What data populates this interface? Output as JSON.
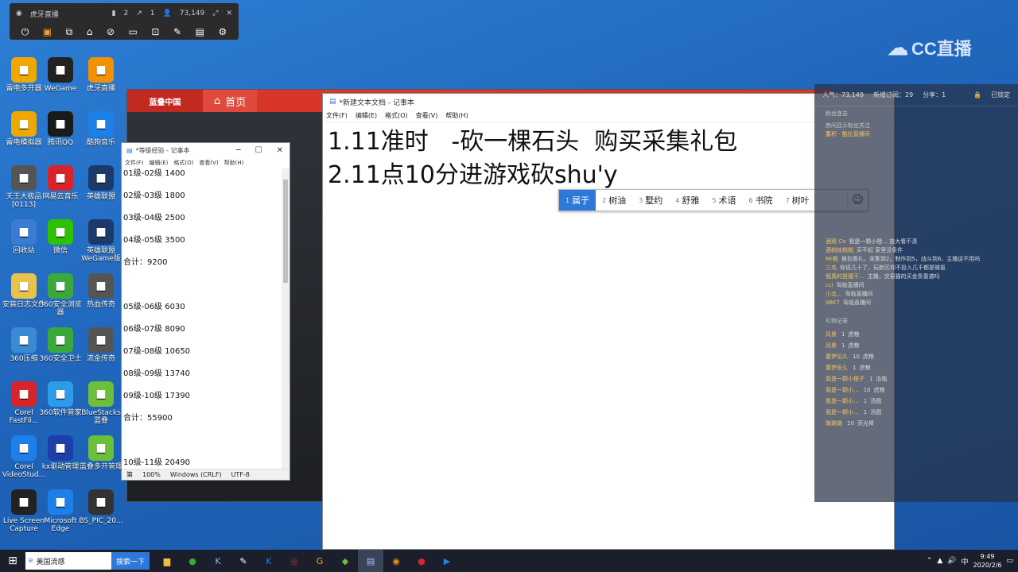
{
  "stream_bar": {
    "title": "虎牙直播",
    "stat1": "2",
    "stat2": "1",
    "viewers": "73,149"
  },
  "cc_logo": "CC直播",
  "desktop_icons": [
    {
      "label": "雷电多开器",
      "color": "#f0a800"
    },
    {
      "label": "WeGame",
      "color": "#222"
    },
    {
      "label": "虎牙直播",
      "color": "#f29200"
    },
    {
      "label": "雷电模拟器",
      "color": "#f0a800"
    },
    {
      "label": "腾讯QQ",
      "color": "#1a1a1a"
    },
    {
      "label": "酷狗音乐",
      "color": "#1d7fe8"
    },
    {
      "label": "天王大极品 [0113]",
      "color": "#555"
    },
    {
      "label": "网易云音乐",
      "color": "#d8232a"
    },
    {
      "label": "英雄联盟",
      "color": "#1b3a6b"
    },
    {
      "label": "回收站",
      "color": "#3a7bd5"
    },
    {
      "label": "微信",
      "color": "#2dc100"
    },
    {
      "label": "英雄联盟 WeGame版",
      "color": "#1b3a6b"
    },
    {
      "label": "安装日志文件",
      "color": "#e8c24a"
    },
    {
      "label": "360安全浏览器",
      "color": "#3aa83a"
    },
    {
      "label": "热血传奇",
      "color": "#555"
    },
    {
      "label": "360压缩",
      "color": "#3a8ad5"
    },
    {
      "label": "360安全卫士",
      "color": "#3aa83a"
    },
    {
      "label": "流金传奇",
      "color": "#555"
    },
    {
      "label": "Corel FastFli...",
      "color": "#d8232a"
    },
    {
      "label": "360软件管家",
      "color": "#2d9be8"
    },
    {
      "label": "BlueStacks 蓝叠",
      "color": "#6bbf3a"
    },
    {
      "label": "Corel VideoStud...",
      "color": "#1d7fe8"
    },
    {
      "label": "kx驱动管理",
      "color": "#1d3fa8"
    },
    {
      "label": "蓝叠多开管理",
      "color": "#6bbf3a"
    },
    {
      "label": "Live Screen Capture",
      "color": "#222"
    },
    {
      "label": "Microsoft Edge",
      "color": "#1d7fe8"
    },
    {
      "label": "BS_PIC_20...",
      "color": "#333"
    }
  ],
  "game_window": {
    "brand": "蓝叠中国",
    "home_tab": "首页"
  },
  "notepad_main": {
    "title": "*新建文本文档 - 记事本",
    "menu": [
      "文件(F)",
      "编辑(E)",
      "格式(O)",
      "查看(V)",
      "帮助(H)"
    ],
    "line1": "1.11准时   -砍一棵石头  购买采集礼包",
    "line2": "2.11点10分进游戏砍shu'y"
  },
  "ime": {
    "candidates": [
      {
        "n": "1",
        "text": "属于"
      },
      {
        "n": "2",
        "text": "树油"
      },
      {
        "n": "3",
        "text": "墅约"
      },
      {
        "n": "4",
        "text": "舒雅"
      },
      {
        "n": "5",
        "text": "术语"
      },
      {
        "n": "6",
        "text": "书院"
      },
      {
        "n": "7",
        "text": "树叶"
      }
    ],
    "emoji": "☺"
  },
  "notepad_small": {
    "title": "*等级经验 - 记事本",
    "menu": [
      "文件(F)",
      "编辑(E)",
      "格式(O)",
      "查看(V)",
      "帮助(H)"
    ],
    "lines": [
      "01级-02级  1400",
      "02级-03级  1800",
      "03级-04级  2500",
      "04级-05级  3500",
      "合计：9200",
      "",
      "05级-06级  6030",
      "06级-07级  8090",
      "07级-08级  10650",
      "08级-09级  13740",
      "09级-10级  17390",
      "合计：55900",
      "",
      "10级-11级  20490"
    ],
    "status": [
      "第",
      "100%",
      "Windows (CRLF)",
      "UTF-8"
    ]
  },
  "chat": {
    "header": {
      "viewers": "人气：73,149",
      "new_fans": "新增订阅：29",
      "share": "分享：1",
      "locked": "已锁定"
    },
    "section1": "粉丝连击",
    "notice1": "房间显示粉丝关注",
    "notice2": "蓄积 · 酷拉直播间",
    "messages": [
      {
        "user": "酒窝 Co",
        "text": "我是一颗小橙... 放大看不清"
      },
      {
        "user": "酒桃枝桃桃",
        "text": "买不起 家里没条件"
      },
      {
        "user": "Mr枫",
        "text": "换包看礼，采集到2，制作到5，战斗到6，主播这不用吗"
      },
      {
        "user": "三毛",
        "text": "你说几十了，玩新区你不投入几千都是微氪"
      },
      {
        "user": "我真的是骚不...",
        "text": "主播，交易猫的买金条靠谱吗"
      },
      {
        "user": "cci",
        "text": "驾临直播间"
      },
      {
        "user": "小北...",
        "text": "驾临直播间"
      },
      {
        "user": "98K7",
        "text": "驾临直播间"
      }
    ],
    "section2": "礼物记录",
    "gifts": [
      {
        "user": "风景",
        "count": "1",
        "gift": "虎粮"
      },
      {
        "user": "风景",
        "count": "1",
        "gift": "虎粮"
      },
      {
        "user": "噩梦伍久",
        "count": "10",
        "gift": "虎粮"
      },
      {
        "user": "噩梦伍久",
        "count": "1",
        "gift": "虎粮"
      },
      {
        "user": "我是一颗小橙子",
        "count": "1",
        "gift": "血瓶"
      },
      {
        "user": "我是一颗小...",
        "count": "10",
        "gift": "虎粮"
      },
      {
        "user": "我是一颗小...",
        "count": "1",
        "gift": "汤圆"
      },
      {
        "user": "我是一颗小...",
        "count": "1",
        "gift": "汤圆"
      },
      {
        "user": "璐璐璐",
        "count": "10",
        "gift": "荧光棒"
      }
    ]
  },
  "taskbar": {
    "search_value": "美国流感",
    "search_button": "搜索一下",
    "time": "9:49",
    "date": "2020/2/6",
    "ime_indicator": "中"
  }
}
